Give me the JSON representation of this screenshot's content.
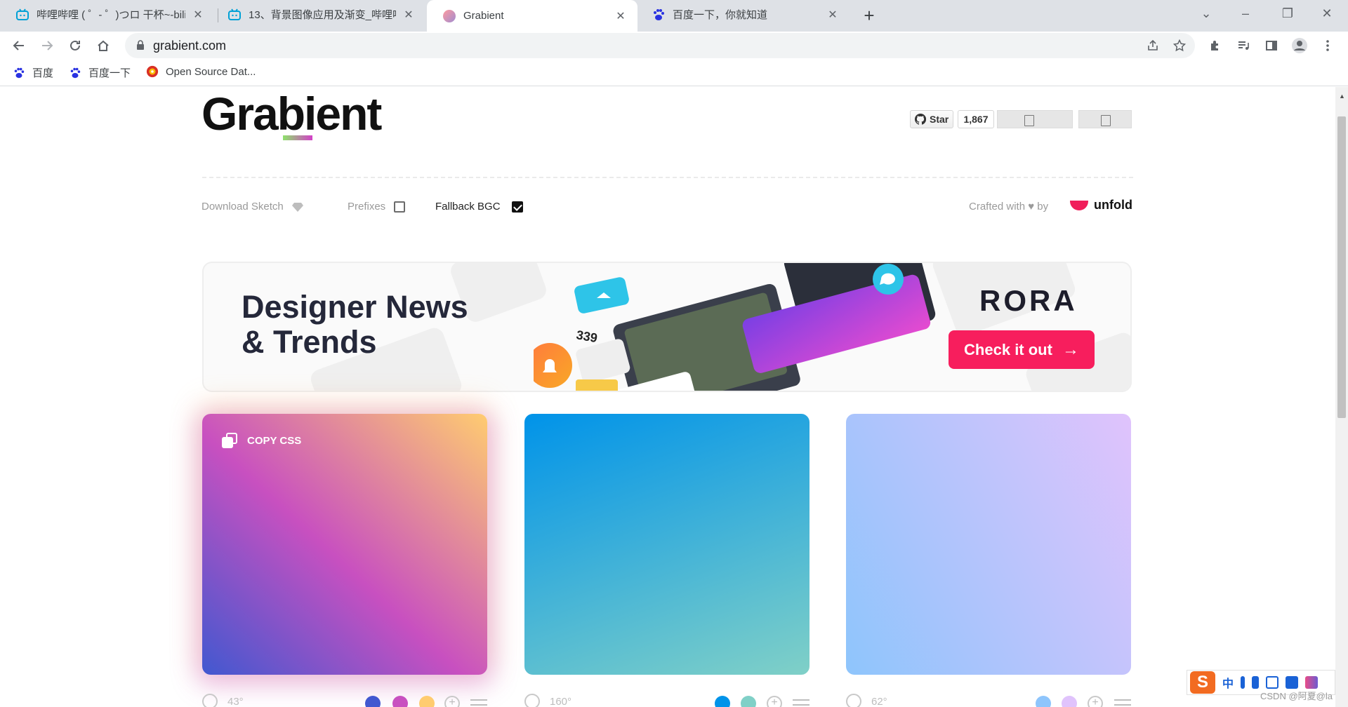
{
  "browser": {
    "tabs": [
      {
        "title": "哔哩哔哩 ( ゜- ゜)つロ 干杯~-bili",
        "favicon": "bilibili-icon",
        "active": false
      },
      {
        "title": "13、背景图像应用及渐变_哔哩哔",
        "favicon": "bilibili-icon",
        "active": false
      },
      {
        "title": "Grabient",
        "favicon": "grabient-icon",
        "active": true
      },
      {
        "title": "百度一下，你就知道",
        "favicon": "baidu-icon",
        "active": false
      }
    ],
    "new_tab_icon": "+",
    "window_controls": {
      "minimize": "–",
      "restore": "❐",
      "close": "✕",
      "tab_search": "⌄"
    },
    "url": "grabient.com",
    "bookmarks": [
      {
        "label": "百度",
        "icon": "baidu-icon"
      },
      {
        "label": "百度一下",
        "icon": "baidu-icon"
      },
      {
        "label": "Open Source Dat...",
        "icon": "database-icon"
      }
    ]
  },
  "page": {
    "logo": "Grabient",
    "github": {
      "star_label": "Star",
      "star_count": "1,867"
    },
    "options": {
      "download_sketch": "Download Sketch",
      "prefixes": "Prefixes",
      "prefixes_checked": false,
      "fallback": "Fallback BGC",
      "fallback_checked": true
    },
    "crafted": "Crafted with ♥ by",
    "unfold": "unfold",
    "ad": {
      "title_line1": "Designer News",
      "title_line2": "& Trends",
      "brand": "RORA",
      "button": "Check it out",
      "button_arrow": "→",
      "art_counter": "339"
    },
    "cards": [
      {
        "copy_label": "COPY CSS",
        "angle": "43°",
        "colors": [
          "#4158D0",
          "#C850C0",
          "#FFCC70"
        ]
      },
      {
        "copy_label": "",
        "angle": "160°",
        "colors": [
          "#0093E9",
          "#80D0C7"
        ]
      },
      {
        "copy_label": "",
        "angle": "62°",
        "colors": [
          "#8EC5FC",
          "#E0C3FC"
        ]
      }
    ]
  },
  "ime": {
    "brand": "S",
    "lang": "中"
  },
  "watermark": "CSDN @阿夏@la"
}
